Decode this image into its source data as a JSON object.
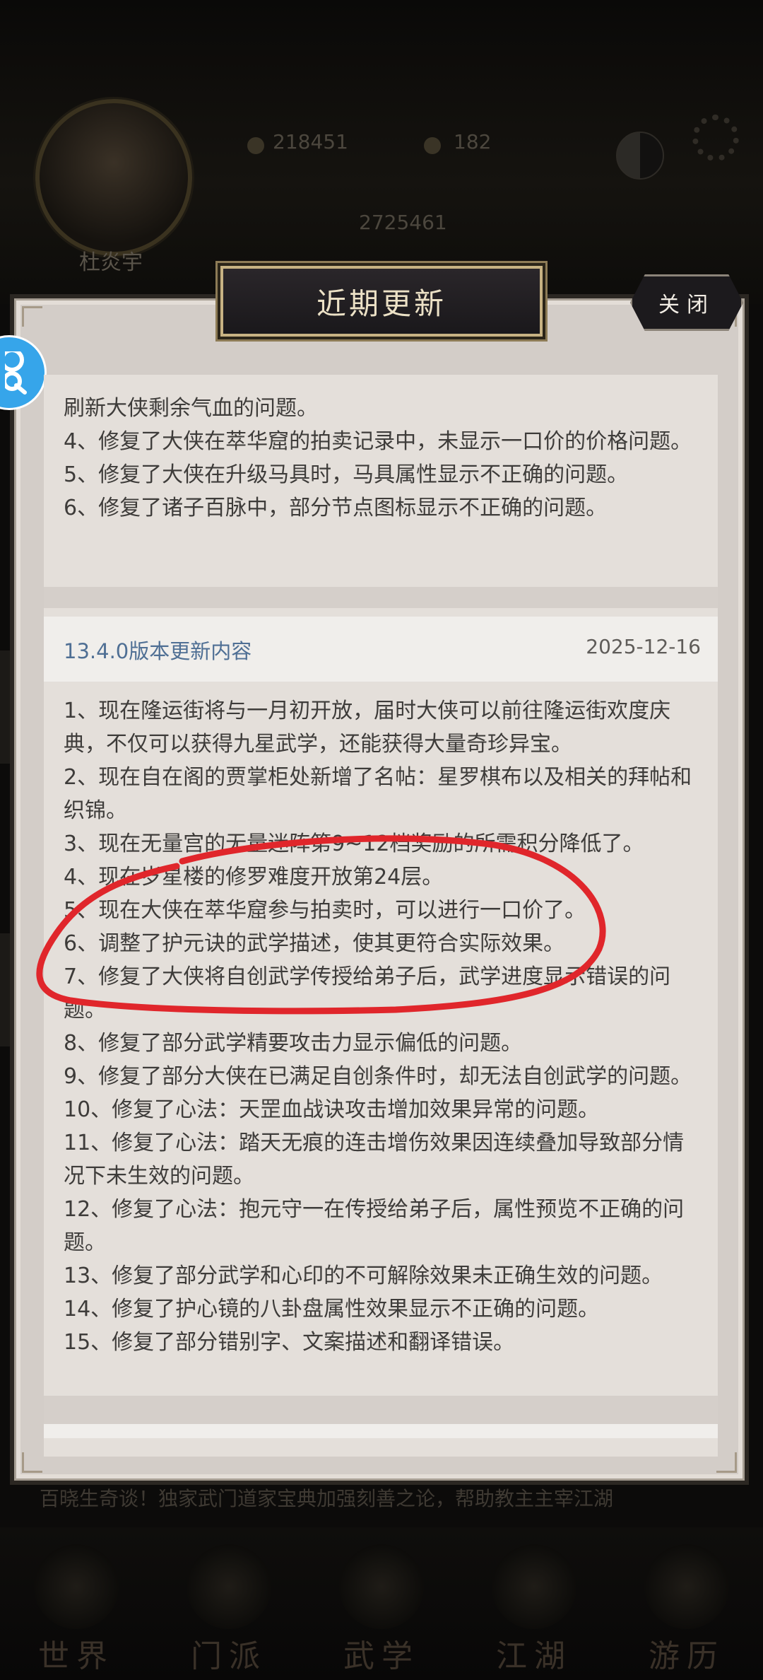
{
  "background": {
    "player_name": "杜炎宇",
    "stat_1": "218451",
    "stat_2": "182",
    "stat_3": "2725461",
    "news_ticker": "百晓生奇谈！独家武门道家宝典加强刻善之论，帮助教主主宰江湖",
    "nav": [
      "世界",
      "门派",
      "武学",
      "江湖",
      "游历"
    ]
  },
  "dialog": {
    "title": "近期更新",
    "close_label": "关闭",
    "prev_version_lines": [
      "刷新大侠剩余气血的问题。",
      "4、修复了大侠在萃华窟的拍卖记录中，未显示一口价的价格问题。",
      "5、修复了大侠在升级马具时，马具属性显示不正确的问题。",
      "6、修复了诸子百脉中，部分节点图标显示不正确的问题。"
    ],
    "version": {
      "title": "13.4.0版本更新内容",
      "date": "2025-12-16",
      "lines": [
        "1、现在隆运街将与一月初开放，届时大侠可以前往隆运街欢度庆典，不仅可以获得九星武学，还能获得大量奇珍异宝。",
        "2、现在自在阁的贾掌柜处新增了名帖：星罗棋布以及相关的拜帖和织锦。",
        "3、现在无量宫的无量迷阵第9~12档奖励的所需积分降低了。",
        "4、现在岁星楼的修罗难度开放第24层。",
        "5、现在大侠在萃华窟参与拍卖时，可以进行一口价了。",
        "6、调整了护元诀的武学描述，使其更符合实际效果。",
        "7、修复了大侠将自创武学传授给弟子后，武学进度显示错误的问题。",
        "8、修复了部分武学精要攻击力显示偏低的问题。",
        "9、修复了部分大侠在已满足自创条件时，却无法自创武学的问题。",
        "10、修复了心法：天罡血战诀攻击增加效果异常的问题。",
        "11、修复了心法：踏天无痕的连击增伤效果因连续叠加导致部分情况下未生效的问题。",
        "12、修复了心法：抱元守一在传授给弟子后，属性预览不正确的问题。",
        "13、修复了部分武学和心印的不可解除效果未正确生效的问题。",
        "14、修复了护心镜的八卦盘属性效果显示不正确的问题。",
        "15、修复了部分错别字、文案描述和翻译错误。"
      ]
    }
  },
  "colors": {
    "annotation_red": "#e0262b",
    "version_title": "#4f6f94",
    "float_button": "#36a5ea"
  }
}
